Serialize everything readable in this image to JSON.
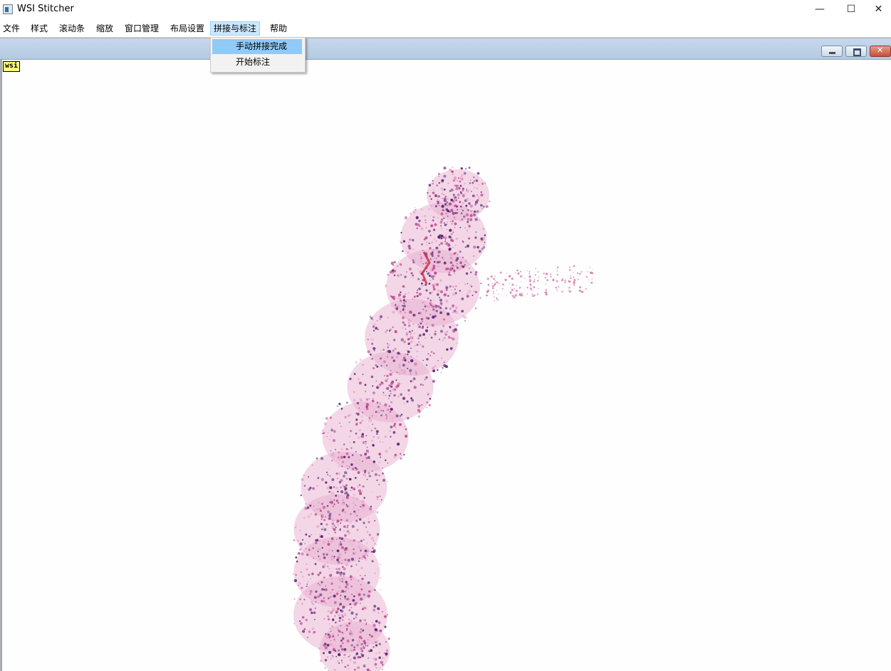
{
  "window": {
    "title": "WSI Stitcher",
    "minimize_symbol": "—",
    "maximize_symbol": "☐",
    "close_symbol": "✕"
  },
  "menubar": {
    "items": [
      {
        "label": "文件"
      },
      {
        "label": "样式"
      },
      {
        "label": "滚动条"
      },
      {
        "label": "缩放"
      },
      {
        "label": "窗口管理"
      },
      {
        "label": "布局设置"
      },
      {
        "label": "拼接与标注"
      },
      {
        "label": "帮助"
      }
    ],
    "active_index": 6
  },
  "dropdown": {
    "items": [
      {
        "label": "手动拼接完成",
        "highlighted": true
      },
      {
        "label": "开始标注",
        "highlighted": false
      }
    ]
  },
  "subwindow": {
    "label": "wsi"
  },
  "colors": {
    "tissue_light": "#e7a9cd",
    "tissue_mid": "#c44d92",
    "tissue_dark": "#5a2a78",
    "blood": "#c0303a",
    "canvas": "#fefefe"
  }
}
